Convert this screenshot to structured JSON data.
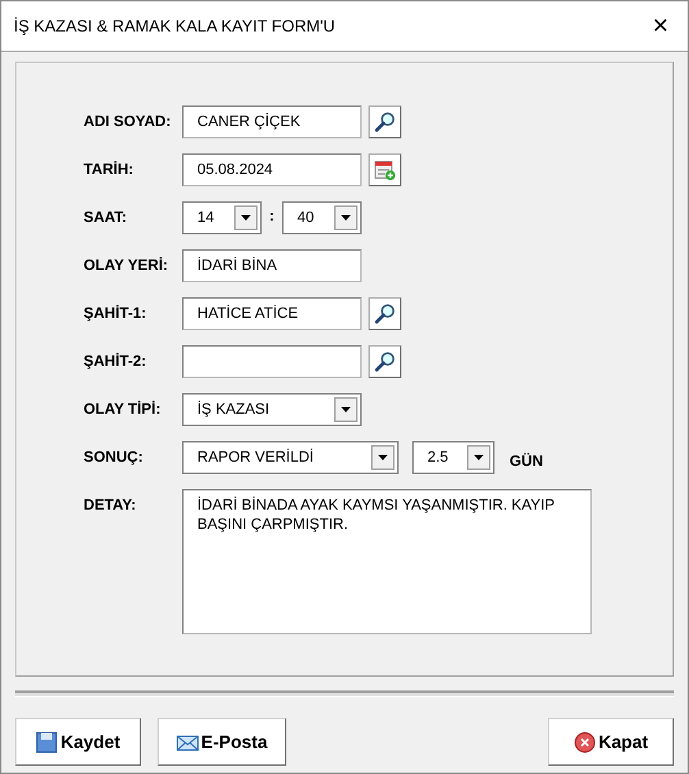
{
  "window": {
    "title": "İŞ KAZASI & RAMAK KALA KAYIT FORM'U",
    "close": "×"
  },
  "rows": [
    {
      "kind": "search",
      "label": "ADI SOYAD:",
      "value": "CANER ÇİÇEK"
    },
    {
      "kind": "calendar",
      "label": "TARİH:",
      "value": "05.08.2024"
    },
    {
      "kind": "time",
      "label": "SAAT:",
      "hour": "14",
      "separator": ":",
      "minute": "40"
    },
    {
      "kind": "text",
      "label": "OLAY YERİ:",
      "value": "İDARİ BİNA"
    },
    {
      "kind": "search",
      "label": "ŞAHİT-1:",
      "value": "HATİCE ATİCE"
    },
    {
      "kind": "search",
      "label": "ŞAHİT-2:",
      "value": ""
    },
    {
      "kind": "select",
      "label": "OLAY TİPİ:",
      "value": "İŞ KAZASI"
    },
    {
      "kind": "result",
      "label": "SONUÇ:",
      "value": "RAPOR VERİLDİ",
      "days": "2.5",
      "unit": "GÜN"
    },
    {
      "kind": "textarea",
      "label": "DETAY:",
      "value": "İDARİ BİNADA AYAK KAYMSI YAŞANMIŞTIR. KAYIP BAŞINI ÇARPMIŞTIR."
    }
  ],
  "buttons": [
    {
      "label": "Kaydet",
      "kind": "save"
    },
    {
      "label": "E-Posta",
      "kind": "mail"
    },
    {
      "label": "Kapat",
      "kind": "close"
    }
  ]
}
